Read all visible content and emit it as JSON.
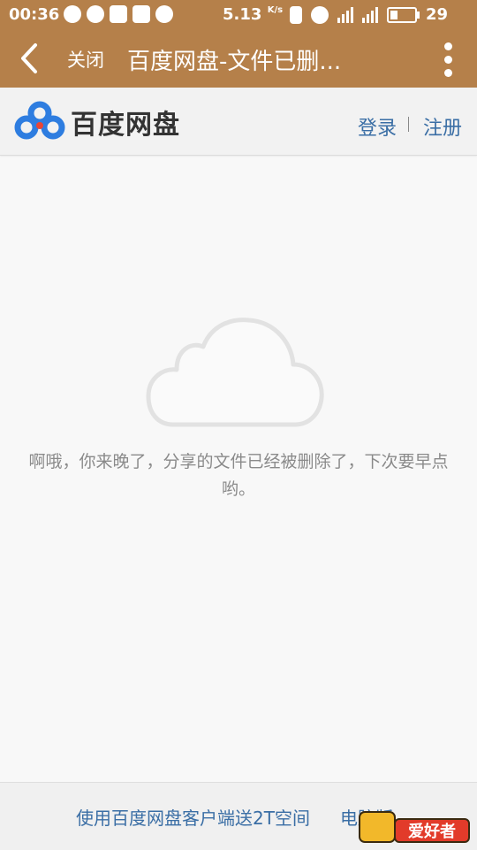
{
  "status_bar": {
    "time": "00:36",
    "speed": "5.13",
    "speed_unit": "K/s",
    "battery": "29",
    "battery_level_percent": 29
  },
  "nav": {
    "close_label": "关闭",
    "title": "百度网盘-文件已删..."
  },
  "site_header": {
    "logo_text": "百度网盘",
    "login_label": "登录",
    "register_label": "注册"
  },
  "main": {
    "message": "啊哦，你来晚了，分享的文件已经被删除了，下次要早点哟。"
  },
  "footer": {
    "promo_link": "使用百度网盘客户端送2T空间",
    "desktop_link": "电脑版"
  },
  "watermark": {
    "text": "爱好者"
  },
  "colors": {
    "toolbar": "#b5804a",
    "link": "#3a6ea5",
    "logo_blue": "#2e7de0",
    "logo_red": "#e84535"
  }
}
